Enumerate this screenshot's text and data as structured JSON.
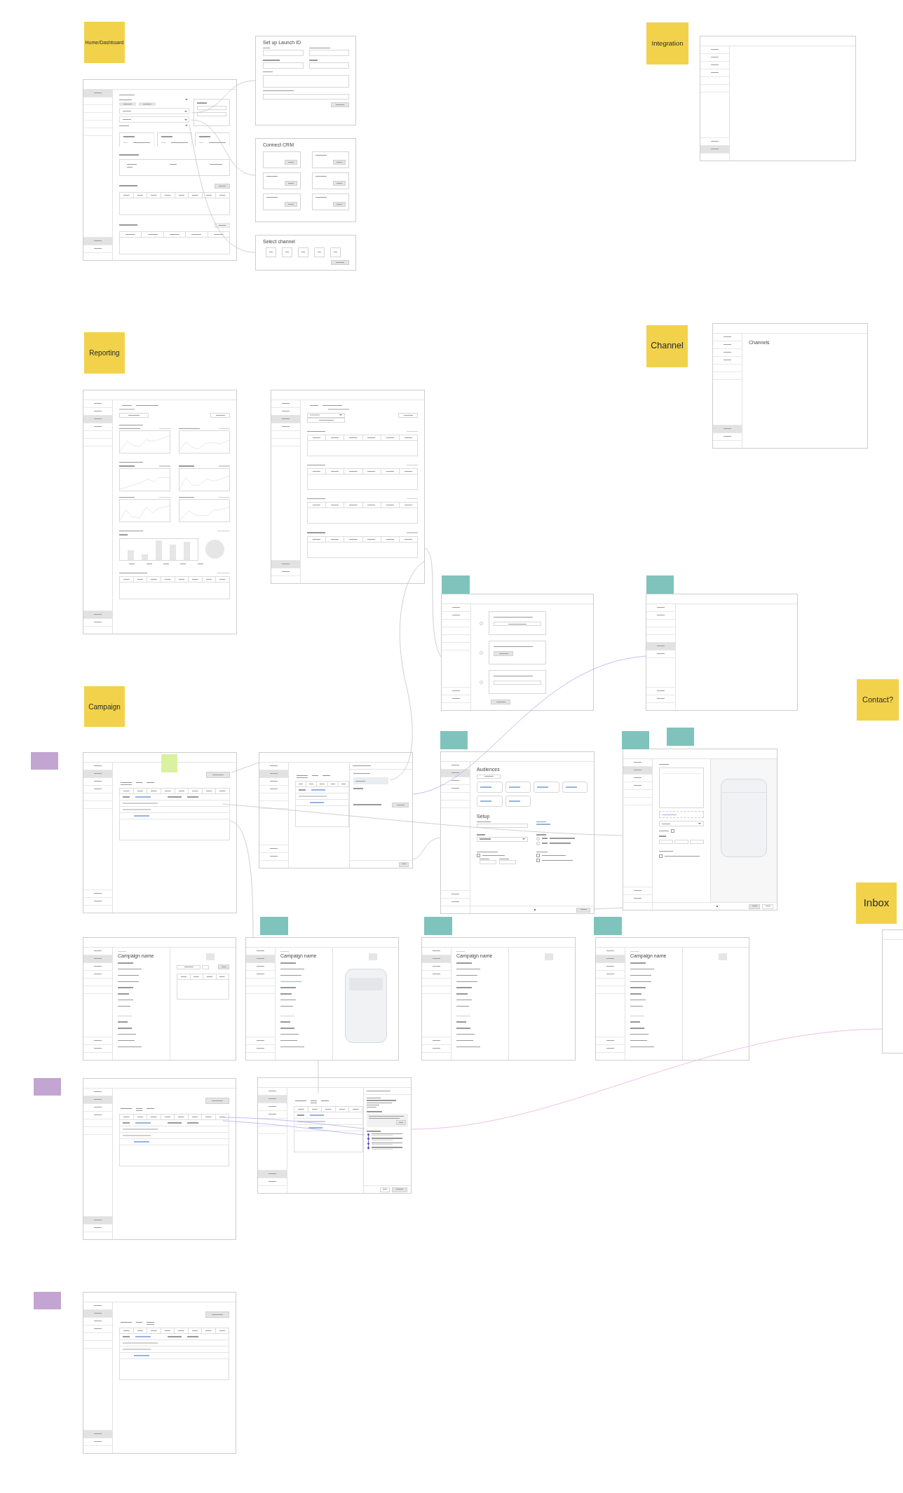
{
  "board": {
    "sticky_notes": [
      {
        "label": "Home/Dashboard",
        "color": "#f2d24b"
      },
      {
        "label": "Integration",
        "color": "#f2d24b"
      },
      {
        "label": "Reporting",
        "color": "#f2d24b"
      },
      {
        "label": "Channel",
        "color": "#f2d24b"
      },
      {
        "color": "#7fc3bc"
      },
      {
        "color": "#7fc3bc"
      },
      {
        "label": "Campaign",
        "color": "#f2d24b"
      },
      {
        "label": "Contact?",
        "color": "#f2d24b"
      },
      {
        "color": "#c3a5d1"
      },
      {
        "color": "#d9f1a0"
      },
      {
        "color": "#7fc3bc"
      },
      {
        "color": "#7fc3bc"
      },
      {
        "color": "#7fc3bc"
      },
      {
        "label": "Inbox",
        "color": "#f2d24b"
      },
      {
        "color": "#7fc3bc"
      },
      {
        "color": "#7fc3bc"
      },
      {
        "color": "#7fc3bc"
      },
      {
        "color": "#c3a5d1"
      },
      {
        "color": "#c3a5d1"
      }
    ],
    "wireframes": [
      {
        "kind": "dashboard",
        "sidebar": [
          {
            "selected": true
          }
        ],
        "sidebar_footer": [
          {
            "selected": true
          },
          {
            "selected": false
          }
        ]
      },
      {
        "kind": "form-modal",
        "title": "Set up Launch ID"
      },
      {
        "kind": "card-modal",
        "title": "Connect CRM"
      },
      {
        "kind": "option-modal",
        "title": "Select channel"
      },
      {
        "kind": "blank-app",
        "sidebar": [
          {
            "selected": false
          },
          {
            "selected": false
          },
          {
            "selected": false
          },
          {
            "selected": false
          }
        ],
        "sidebar_footer": [
          {
            "selected": false
          },
          {
            "selected": true
          }
        ]
      },
      {
        "kind": "blank-app",
        "title": "Channels",
        "sidebar": [
          {
            "selected": false
          },
          {
            "selected": false
          },
          {
            "selected": false
          },
          {
            "selected": false
          }
        ],
        "sidebar_footer": [
          {
            "selected": true
          },
          {
            "selected": false
          }
        ]
      },
      {
        "kind": "report-charts",
        "sidebar": [
          {
            "selected": false
          },
          {
            "selected": false
          },
          {
            "selected": true
          },
          {
            "selected": false
          }
        ],
        "sidebar_footer": [
          {
            "selected": true
          },
          {
            "selected": false
          }
        ]
      },
      {
        "kind": "report-tables",
        "sidebar": [
          {
            "selected": false
          },
          {
            "selected": false
          },
          {
            "selected": true
          },
          {
            "selected": false
          }
        ],
        "sidebar_footer": [
          {
            "selected": true
          },
          {
            "selected": false
          }
        ]
      },
      {
        "kind": "steps",
        "sidebar": [
          {
            "selected": false
          },
          {
            "selected": false
          }
        ],
        "sidebar_footer": [
          {
            "selected": false
          },
          {
            "selected": false
          }
        ]
      },
      {
        "kind": "blank-app",
        "sidebar": [
          {
            "selected": false
          },
          {
            "selected": false
          }
        ],
        "sidebar_group_2": [
          {
            "selected": true
          },
          {
            "selected": false
          }
        ],
        "sidebar_footer": [
          {
            "selected": false
          },
          {
            "selected": false
          }
        ]
      },
      {
        "kind": "campaign-list",
        "sidebar": [
          {
            "selected": false
          },
          {
            "selected": true
          },
          {
            "selected": false
          },
          {
            "selected": false
          }
        ],
        "sidebar_footer": [
          {
            "selected": false
          },
          {
            "selected": false
          }
        ],
        "tabs": [
          {
            "selected": true
          },
          {
            "selected": false
          },
          {
            "selected": false
          }
        ]
      },
      {
        "kind": "campaign-panel",
        "sidebar": [
          {
            "selected": false
          },
          {
            "selected": true
          },
          {
            "selected": false
          },
          {
            "selected": false
          }
        ],
        "sidebar_footer": [
          {
            "selected": false
          },
          {
            "selected": false
          }
        ],
        "tabs": [
          {
            "selected": true
          },
          {
            "selected": false
          },
          {
            "selected": false
          }
        ]
      },
      {
        "kind": "audience-setup",
        "title": "Audiences",
        "section_title": "Setup",
        "sidebar": [
          {
            "selected": false
          },
          {
            "selected": true
          },
          {
            "selected": false
          },
          {
            "selected": false
          }
        ],
        "sidebar_footer": [
          {
            "selected": false
          },
          {
            "selected": false
          }
        ],
        "radio_options": [
          {
            "selected": false
          },
          {
            "selected": false
          }
        ],
        "checkboxes": [
          {
            "checked": false
          },
          {
            "checked": false
          },
          {
            "checked": false
          }
        ]
      },
      {
        "kind": "composer",
        "sidebar": [
          {
            "selected": false
          },
          {
            "selected": true
          },
          {
            "selected": false
          },
          {
            "selected": false
          }
        ],
        "sidebar_footer": [
          {
            "selected": false
          },
          {
            "selected": false
          }
        ],
        "checkboxes": [
          {
            "checked": false
          },
          {
            "checked": false
          }
        ]
      },
      {
        "kind": "detail-table",
        "title": "Campaign name",
        "sidebar": [
          {
            "selected": false
          },
          {
            "selected": true
          },
          {
            "selected": false
          },
          {
            "selected": false
          }
        ],
        "sidebar_footer": [
          {
            "selected": false
          },
          {
            "selected": false
          }
        ]
      },
      {
        "kind": "detail-phone",
        "title": "Campaign name",
        "sidebar": [
          {
            "selected": false
          },
          {
            "selected": true
          },
          {
            "selected": false
          },
          {
            "selected": false
          }
        ],
        "sidebar_footer": [
          {
            "selected": false
          },
          {
            "selected": false
          }
        ]
      },
      {
        "kind": "detail",
        "title": "Campaign name",
        "sidebar": [
          {
            "selected": false
          },
          {
            "selected": true
          },
          {
            "selected": false
          },
          {
            "selected": false
          }
        ],
        "sidebar_footer": [
          {
            "selected": false
          },
          {
            "selected": false
          }
        ]
      },
      {
        "kind": "detail",
        "title": "Campaign name",
        "sidebar": [
          {
            "selected": false
          },
          {
            "selected": true
          },
          {
            "selected": false
          },
          {
            "selected": false
          }
        ],
        "sidebar_footer": [
          {
            "selected": false
          },
          {
            "selected": false
          }
        ]
      },
      {
        "kind": "edge"
      },
      {
        "kind": "campaign-list",
        "sidebar": [
          {
            "selected": false
          },
          {
            "selected": true
          },
          {
            "selected": false
          },
          {
            "selected": false
          }
        ],
        "sidebar_footer": [
          {
            "selected": true
          },
          {
            "selected": false
          }
        ],
        "tabs": [
          {
            "selected": false
          },
          {
            "selected": true
          },
          {
            "selected": false
          }
        ]
      },
      {
        "kind": "timeline-panel",
        "sidebar": [
          {
            "selected": false
          },
          {
            "selected": true
          },
          {
            "selected": false
          },
          {
            "selected": false
          }
        ],
        "sidebar_footer": [
          {
            "selected": true
          },
          {
            "selected": false
          }
        ],
        "tabs": [
          {
            "selected": false
          },
          {
            "selected": true
          },
          {
            "selected": false
          }
        ]
      },
      {
        "kind": "campaign-list",
        "sidebar": [
          {
            "selected": false
          },
          {
            "selected": true
          },
          {
            "selected": false
          },
          {
            "selected": false
          }
        ],
        "sidebar_footer": [
          {
            "selected": true
          },
          {
            "selected": false
          }
        ],
        "tabs": [
          {
            "selected": false
          },
          {
            "selected": false
          },
          {
            "selected": true
          }
        ]
      }
    ]
  }
}
